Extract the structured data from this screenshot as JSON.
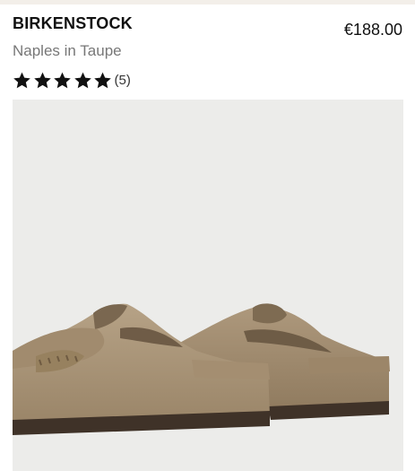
{
  "product": {
    "brand": "BIRKENSTOCK",
    "name": "Naples in Taupe",
    "price": "€188.00",
    "rating": {
      "stars": 5,
      "max": 5,
      "count_label": "(5)"
    }
  },
  "image": {
    "subject": "taupe-suede-mule-pair-icon"
  },
  "colors": {
    "background": "#ffffff",
    "image_bg": "#ececea",
    "suede": "#a89479",
    "sole": "#4a3c30",
    "text_primary": "#111111",
    "text_secondary": "#777777"
  }
}
